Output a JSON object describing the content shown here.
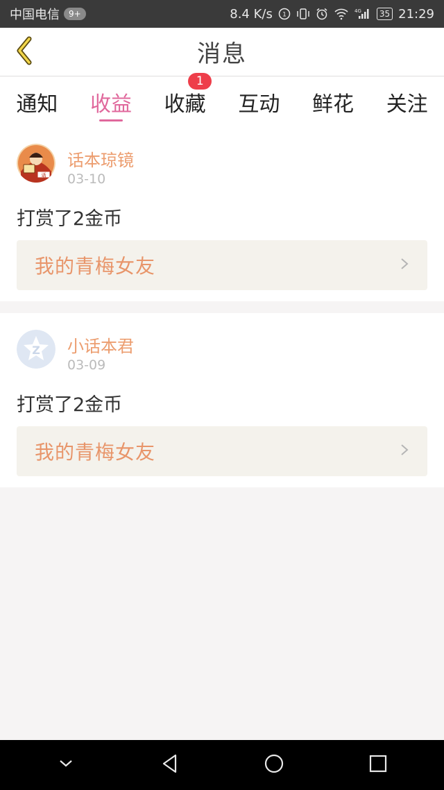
{
  "status_bar": {
    "carrier": "中国电信",
    "badge": "9+",
    "speed": "8.4 K/s",
    "battery": "35",
    "time": "21:29"
  },
  "header": {
    "title": "消息"
  },
  "tabs": [
    {
      "label": "通知",
      "active": false
    },
    {
      "label": "收益",
      "active": true
    },
    {
      "label": "收藏",
      "active": false,
      "badge": "1"
    },
    {
      "label": "互动",
      "active": false
    },
    {
      "label": "鲜花",
      "active": false
    },
    {
      "label": "关注",
      "active": false
    }
  ],
  "messages": [
    {
      "username": "话本琼镜",
      "date": "03-10",
      "action": "打赏了2金币",
      "book_title": "我的青梅女友"
    },
    {
      "username": "小话本君",
      "date": "03-09",
      "action": "打赏了2金币",
      "book_title": "我的青梅女友"
    }
  ],
  "colors": {
    "accent_pink": "#e0689c",
    "username_orange": "#ec9d6f",
    "book_orange": "#e8956a",
    "badge_red": "#ee3e4a"
  }
}
